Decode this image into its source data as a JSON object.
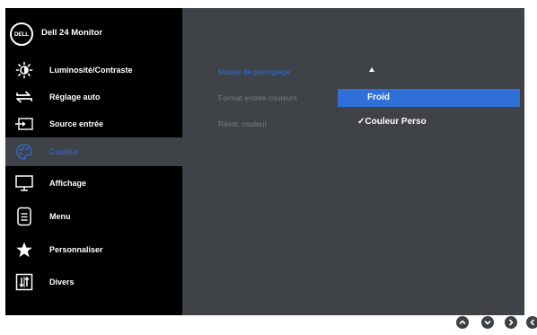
{
  "header": {
    "logo_text": "DELL",
    "title": "Dell 24 Monitor"
  },
  "sidebar": {
    "items": [
      {
        "label": "Luminosité/Contraste",
        "icon": "brightness-icon"
      },
      {
        "label": "Réglage auto",
        "icon": "auto-adjust-icon"
      },
      {
        "label": "Source entrée",
        "icon": "input-source-icon"
      },
      {
        "label": "Couleur",
        "icon": "color-palette-icon"
      },
      {
        "label": "Affichage",
        "icon": "display-icon"
      },
      {
        "label": "Menu",
        "icon": "menu-icon"
      },
      {
        "label": "Personnaliser",
        "icon": "star-icon"
      },
      {
        "label": "Divers",
        "icon": "others-icon"
      }
    ]
  },
  "main": {
    "options": [
      {
        "label": "Modes de préréglage"
      },
      {
        "label": "Format entrée couleurs"
      },
      {
        "label": "Réinit. couleur"
      }
    ],
    "choices": [
      {
        "label": "Froid"
      },
      {
        "label": "✓Couleur Perso"
      }
    ]
  },
  "navigation": {
    "buttons": [
      "up-icon",
      "down-icon",
      "right-icon",
      "back-icon"
    ]
  },
  "colors": {
    "accent": "#2e6fd8",
    "panel": "#3f4246",
    "background": "#000000"
  }
}
